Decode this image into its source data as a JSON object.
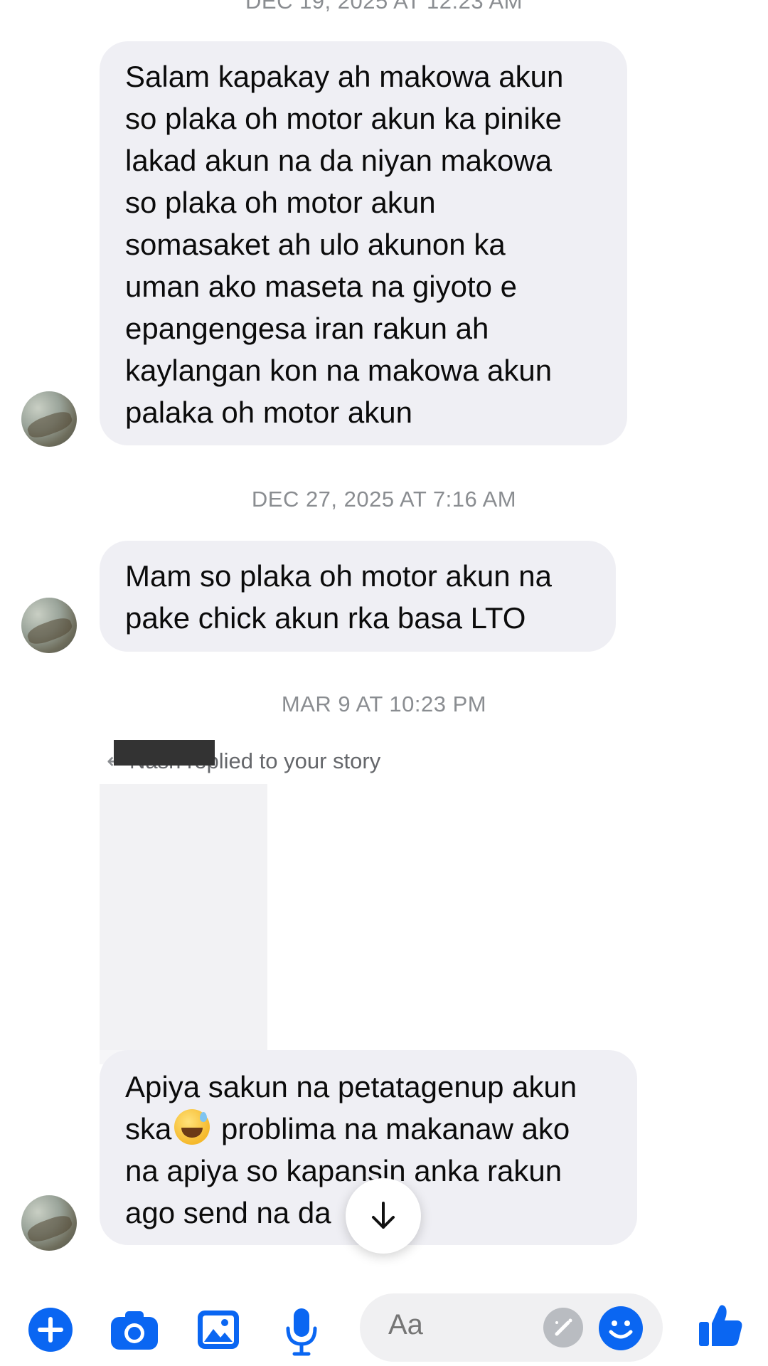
{
  "thread": {
    "timestamps": {
      "top_partial": "DEC 19, 2025 AT 12:23 AM",
      "second": "DEC 27, 2025 AT 7:16 AM",
      "third": "MAR 9 AT 10:23 PM"
    },
    "messages": [
      {
        "lines": [
          "Salam kapakay ah makowa akun",
          "so plaka oh motor akun ka pinike",
          "lakad akun na da niyan makowa",
          "so plaka oh motor akun",
          "somasaket ah ulo akunon ka",
          "uman ako maseta na giyoto e",
          "epangengesa iran rakun ah",
          "kaylangan kon na makowa akun",
          "palaka oh motor akun"
        ]
      },
      {
        "lines": [
          "Mam so plaka oh motor akun na",
          "pake chick akun rka basa LTO"
        ]
      },
      {
        "line1": "Apiya sakun na petatagenup akun",
        "line2_before": "ska",
        "line2_after": " problima na makanaw ako",
        "line3": "na apiya so kapansin anka rakun",
        "line4": "ago send na da"
      }
    ],
    "story_reply": {
      "text": "Nash replied to your story"
    }
  },
  "icons": {
    "emoji": "sweat-smile-emoji",
    "scroll": "arrow-down-icon"
  },
  "composer": {
    "placeholder": "Aa"
  },
  "colors": {
    "accent": "#0a66f2",
    "bubble": "#efeff4",
    "timestamp": "#8a8d91"
  }
}
